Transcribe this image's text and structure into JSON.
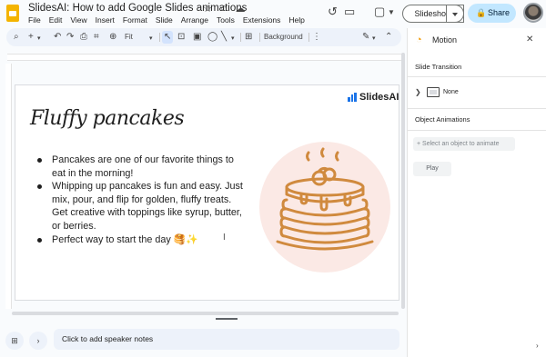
{
  "app": {
    "title": "SlidesAI: How to add Google Slides animations",
    "menus": [
      "File",
      "Edit",
      "View",
      "Insert",
      "Format",
      "Slide",
      "Arrange",
      "Tools",
      "Extensions",
      "Help"
    ],
    "title_icons": [
      "star-icon",
      "move-to-folder-icon",
      "cloud-status-icon"
    ],
    "slideshow_label": "Slideshow",
    "share_label": "Share"
  },
  "toolbar": {
    "zoom": "Fit",
    "background_label": "Background"
  },
  "slide": {
    "title": "Fluffy pancakes",
    "logo_text": "SlidesAI",
    "bullets": [
      "Pancakes are one of our favorite things to eat in the morning!",
      "Whipping up pancakes is fun and easy. Just mix, pour, and flip for golden, fluffy treats. Get creative with toppings like syrup, butter, or berries.",
      "Perfect way to start the day 🥞✨"
    ],
    "image_icon": "pancake-stack-icon"
  },
  "notes": {
    "placeholder": "Click to add speaker notes"
  },
  "panel": {
    "title": "Motion",
    "slide_transition_label": "Slide Transition",
    "transition_value": "None",
    "object_animations_label": "Object Animations",
    "select_object_label": "Select an object to animate",
    "play_label": "Play"
  },
  "colors": {
    "accent": "#c2e7ff",
    "pancake": "#d08a3e",
    "circle": "#fbe9e5",
    "logo_blue": "#1a73e8"
  }
}
